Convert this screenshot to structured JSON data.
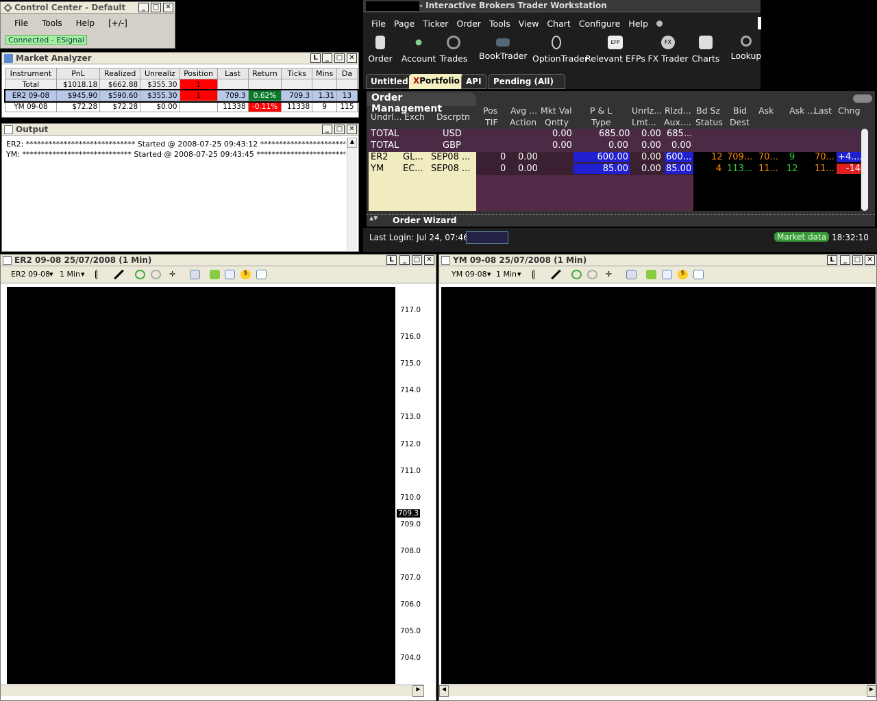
{
  "control_center": {
    "title": "Control Center - Default",
    "menu": [
      "File",
      "Tools",
      "Help",
      "[+/-]"
    ],
    "status": "Connected - ESignal"
  },
  "market_analyzer": {
    "title": "Market Analyzer",
    "columns": [
      "Instrument",
      "PnL",
      "Realized",
      "Unrealiz",
      "Position",
      "Last",
      "Return",
      "Ticks",
      "Mins",
      "Da"
    ],
    "rows": [
      {
        "instrument": "Total",
        "pnl": "$1018.18",
        "realized": "$662.88",
        "unrealized": "$355.30",
        "position": "1",
        "last": "",
        "ret": "",
        "ticks": "",
        "mins": "",
        "da": ""
      },
      {
        "instrument": "ER2 09-08",
        "pnl": "$945.90",
        "realized": "$590.60",
        "unrealized": "$355.30",
        "position": "1",
        "last": "709.3",
        "ret": "0.62%",
        "ticks": "709.3",
        "mins": "1.31",
        "da": "13"
      },
      {
        "instrument": "YM 09-08",
        "pnl": "$72.28",
        "realized": "$72.28",
        "unrealized": "$0.00",
        "position": "",
        "last": "11338",
        "ret": "-0.11%",
        "ticks": "11338",
        "mins": "9",
        "da": "115"
      }
    ]
  },
  "output": {
    "title": "Output",
    "lines": [
      "ER2: ***************************** Started @ 2008-07-25 09:43:12 *****************************",
      "YM: ***************************** Started @ 2008-07-25 09:43:45 *****************************"
    ]
  },
  "tws": {
    "title": "- Interactive Brokers Trader Workstation",
    "menu": [
      "File",
      "Page",
      "Ticker",
      "Order",
      "Tools",
      "View",
      "Chart",
      "Configure",
      "Help"
    ],
    "tools": [
      "Order",
      "Account",
      "Trades",
      "BookTrader",
      "OptionTrader",
      "Relevant EFPs",
      "FX Trader",
      "Charts",
      "Lookup"
    ],
    "tabs": [
      "Untitled",
      "Portfolio",
      "API",
      "Pending (All)"
    ],
    "om_title": "Order Management",
    "headers_top": [
      "Pos",
      "Avg ...",
      "Mkt Val",
      "P & L",
      "Unrlz...",
      "Rlzd...",
      "Bd Sz",
      "Bid",
      "Ask",
      "Ask ...",
      "Last",
      "Chng"
    ],
    "headers_bottom": [
      "Undrl...",
      "Exch",
      "Dscrptn",
      "TIF",
      "Action",
      "Qntty",
      "Type",
      "Lmt...",
      "Aux....",
      "Status",
      "Dest"
    ],
    "totals": [
      {
        "label": "TOTAL",
        "cur": "USD",
        "mkt": "0.00",
        "pnl": "685.00",
        "unr": "0.00",
        "rlz": "685..."
      },
      {
        "label": "TOTAL",
        "cur": "GBP",
        "mkt": "0.00",
        "pnl": "0.00",
        "unr": "0.00",
        "rlz": "0.00"
      }
    ],
    "positions": [
      {
        "sym": "ER2",
        "exch": "GL...",
        "desc": "SEP08 ...",
        "pos": "0",
        "avg": "0.00",
        "pnl": "600.00",
        "unr": "0.00",
        "rlz": "600...",
        "bdsz": "12",
        "bid": "709...",
        "ask": "70...",
        "asksz": "9",
        "last": "70...",
        "chng": "+4...."
      },
      {
        "sym": "YM",
        "exch": "EC...",
        "desc": "SEP08 ...",
        "pos": "0",
        "avg": "0.00",
        "pnl": "85.00",
        "unr": "0.00",
        "rlz": "85.00",
        "bdsz": "4",
        "bid": "113...",
        "ask": "11...",
        "asksz": "12",
        "last": "11...",
        "chng": "-14"
      }
    ],
    "order_wizard": "Order Wizard",
    "last_login": "Last Login: Jul 24, 07:46",
    "market_data": "Market data",
    "clock": "18:32:10"
  },
  "chart_er2": {
    "title": "ER2 09-08  25/07/2008 (1 Min)",
    "instrument": "ER2 09-08",
    "interval": "1 Min",
    "price_tag": "709.3",
    "yticks": [
      "717.0",
      "716.0",
      "715.0",
      "714.0",
      "713.0",
      "712.0",
      "711.0",
      "710.0",
      "709.0",
      "708.0",
      "707.0",
      "706.0",
      "705.0",
      "704.0"
    ]
  },
  "chart_ym": {
    "title": "YM 09-08  25/07/2008 (1 Min)",
    "instrument": "YM 09-08",
    "interval": "1 Min"
  }
}
